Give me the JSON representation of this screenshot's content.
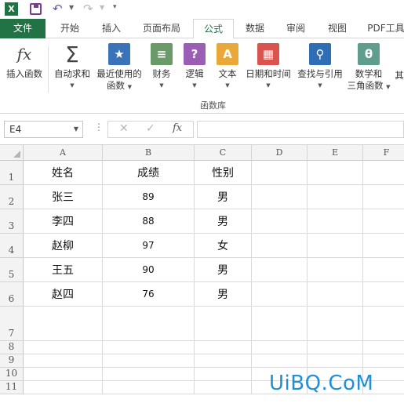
{
  "quick_access": {
    "app_logo": "X",
    "icons": [
      "excel-logo",
      "save-icon",
      "undo-icon",
      "redo-icon",
      "customize-qat-icon"
    ]
  },
  "ribbon_tabs": [
    "文件",
    "开始",
    "插入",
    "页面布局",
    "公式",
    "数据",
    "审阅",
    "视图",
    "PDF工具"
  ],
  "active_tab": "公式",
  "ribbon": {
    "insert_function": "插入函数",
    "autosum": "自动求和",
    "recently_used_1": "最近使用的",
    "recently_used_2": "函数",
    "financial": "财务",
    "logical": "逻辑",
    "text": "文本",
    "datetime": "日期和时间",
    "lookup": "查找与引用",
    "math_1": "数学和",
    "math_2": "三角函数",
    "more": "其",
    "group_label": "函数库",
    "fx_glyph": "fx",
    "sigma_glyph": "Σ",
    "theta_glyph": "θ"
  },
  "formula_bar": {
    "name_box": "E4",
    "fx_label": "fx",
    "formula_value": ""
  },
  "columns": [
    "A",
    "B",
    "C",
    "D",
    "E",
    "F"
  ],
  "rows": [
    "1",
    "2",
    "3",
    "4",
    "5",
    "6",
    "7",
    "8",
    "9",
    "10",
    "11"
  ],
  "table": {
    "header": [
      "姓名",
      "成绩",
      "性别"
    ],
    "data": [
      [
        "张三",
        "89",
        "男"
      ],
      [
        "李四",
        "88",
        "男"
      ],
      [
        "赵柳",
        "97",
        "女"
      ],
      [
        "王五",
        "90",
        "男"
      ],
      [
        "赵四",
        "76",
        "男"
      ]
    ]
  },
  "watermark": "UiBQ.CoM",
  "colors": {
    "excel_green": "#217346",
    "watermark_blue": "#1e90d8"
  }
}
